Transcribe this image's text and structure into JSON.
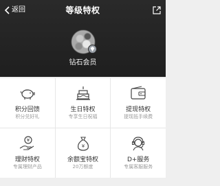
{
  "nav": {
    "back_label": "返回",
    "title": "等级特权"
  },
  "profile": {
    "level_name": "钻石会员"
  },
  "privileges": [
    {
      "name": "积分回馈",
      "desc": "积分兑好礼",
      "icon": "piggy-bank-icon"
    },
    {
      "name": "生日特权",
      "desc": "专享生日祝福",
      "icon": "birthday-cake-icon"
    },
    {
      "name": "提现特权",
      "desc": "提现抵手续费",
      "icon": "wallet-icon"
    },
    {
      "name": "理财特权",
      "desc": "专属理财产品",
      "icon": "hand-money-icon"
    },
    {
      "name": "余额宝特权",
      "desc": "20万额度",
      "icon": "money-bag-icon"
    },
    {
      "name": "D+服务",
      "desc": "专属客服服务",
      "icon": "customer-service-icon"
    }
  ],
  "colors": {
    "header_bg": "#222222",
    "icon_stroke": "#444444"
  }
}
